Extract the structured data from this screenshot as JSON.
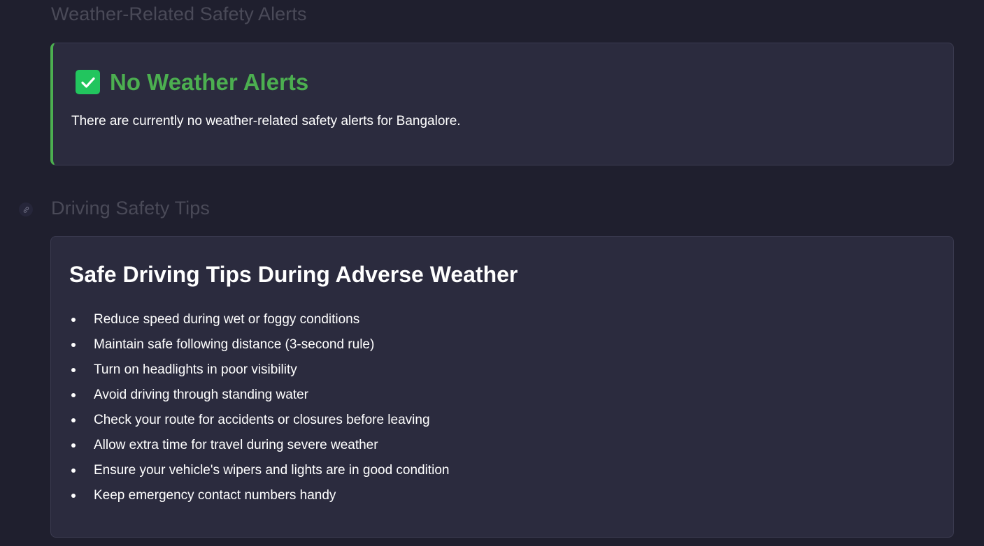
{
  "weather_section": {
    "heading": "Weather-Related Safety Alerts",
    "alert": {
      "icon": "check-mark-icon",
      "title": "No Weather Alerts",
      "message": "There are currently no weather-related safety alerts for Bangalore.",
      "accent_color": "#4caf50",
      "icon_color": "#22c55e"
    }
  },
  "driving_section": {
    "heading": "Driving Safety Tips",
    "anchor_icon": "link-icon",
    "card": {
      "title": "Safe Driving Tips During Adverse Weather",
      "tips": [
        "Reduce speed during wet or foggy conditions",
        "Maintain safe following distance (3-second rule)",
        "Turn on headlights in poor visibility",
        "Avoid driving through standing water",
        "Check your route for accidents or closures before leaving",
        "Allow extra time for travel during severe weather",
        "Ensure your vehicle's wipers and lights are in good condition",
        "Keep emergency contact numbers handy"
      ]
    }
  },
  "colors": {
    "background": "#1f1f2e",
    "card_background": "#2b2b3e",
    "heading_muted": "#4a4a58"
  }
}
